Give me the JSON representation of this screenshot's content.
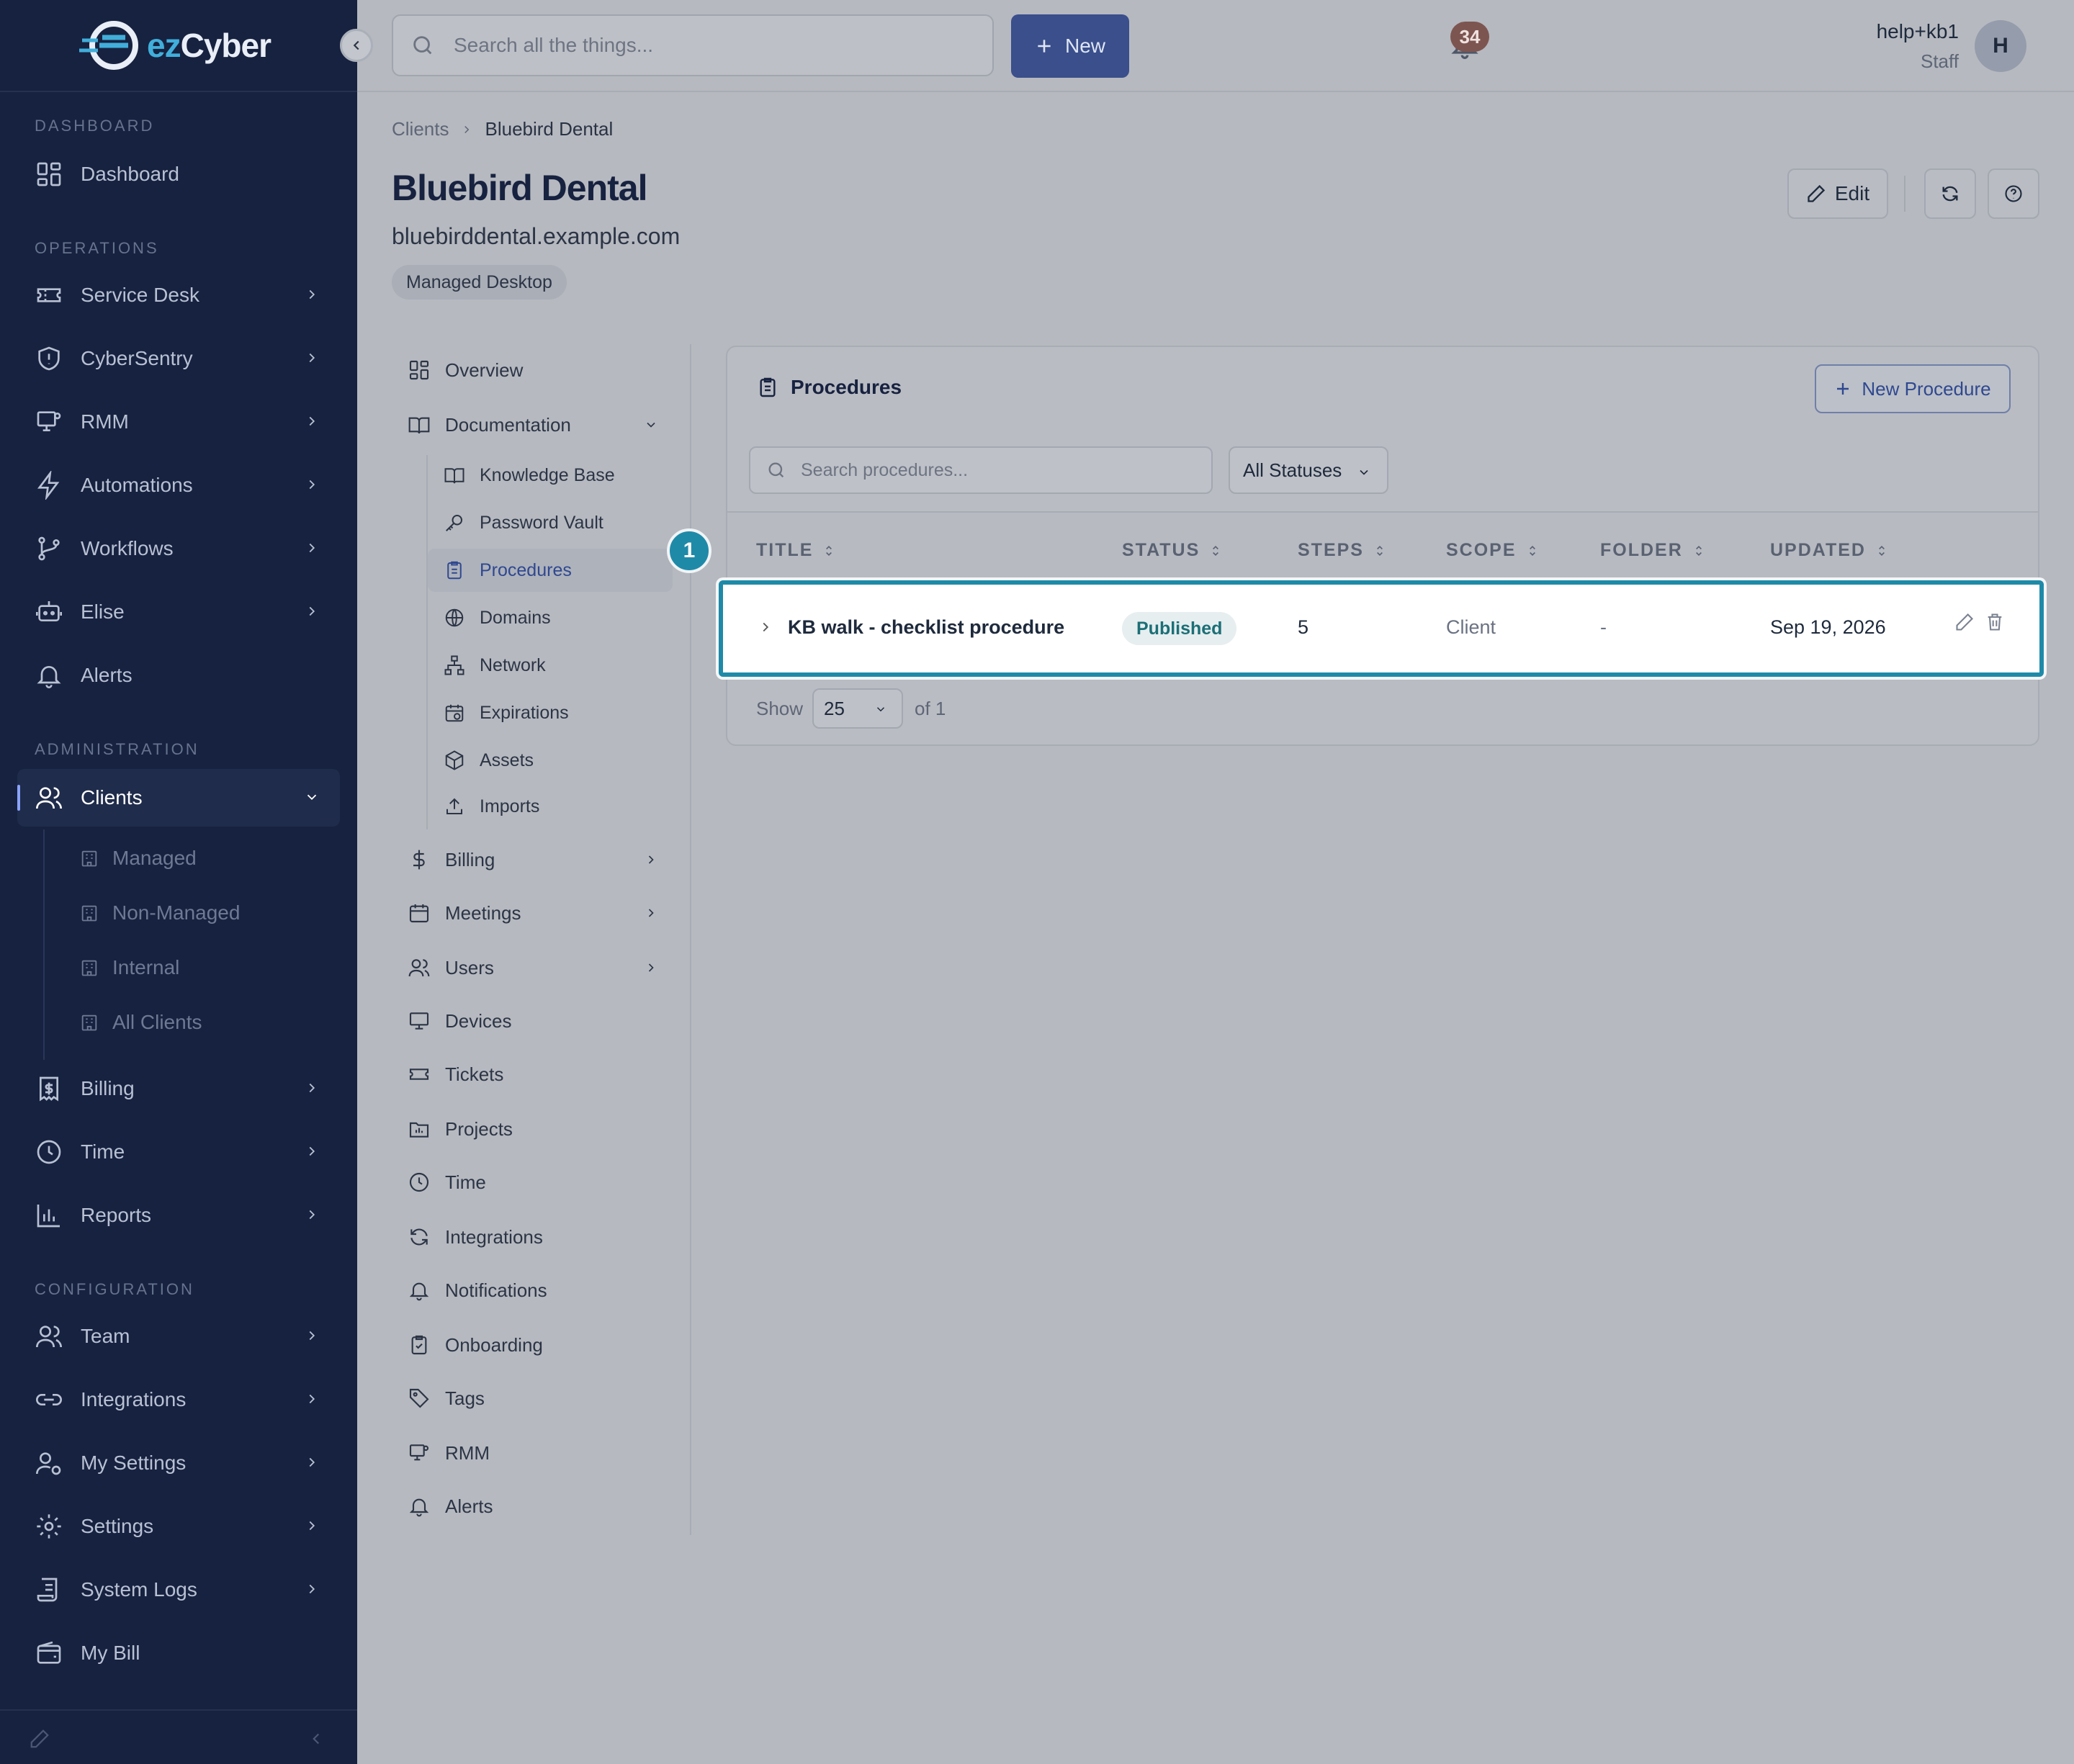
{
  "app": {
    "logo_prefix": "ez",
    "logo_suffix": "Cyber"
  },
  "sidebar": {
    "sections": {
      "dashboard": "DASHBOARD",
      "operations": "OPERATIONS",
      "administration": "ADMINISTRATION",
      "configuration": "CONFIGURATION"
    },
    "items": {
      "dashboard": "Dashboard",
      "service_desk": "Service Desk",
      "cybersentry": "CyberSentry",
      "rmm": "RMM",
      "automations": "Automations",
      "workflows": "Workflows",
      "elise": "Elise",
      "alerts": "Alerts",
      "clients": "Clients",
      "billing": "Billing",
      "time": "Time",
      "reports": "Reports",
      "team": "Team",
      "integrations": "Integrations",
      "my_settings": "My Settings",
      "settings": "Settings",
      "system_logs": "System Logs",
      "my_bill": "My Bill"
    },
    "client_sub": {
      "managed": "Managed",
      "non_managed": "Non-Managed",
      "internal": "Internal",
      "all": "All Clients"
    }
  },
  "topbar": {
    "search_placeholder": "Search all the things...",
    "new_label": "New",
    "notification_count": "34",
    "user_name": "help+kb1",
    "user_role": "Staff",
    "avatar_initial": "H"
  },
  "breadcrumb": {
    "root": "Clients",
    "current": "Bluebird Dental"
  },
  "client": {
    "name": "Bluebird Dental",
    "domain": "bluebirddental.example.com",
    "tag": "Managed Desktop"
  },
  "header_buttons": {
    "edit": "Edit"
  },
  "subnav": {
    "overview": "Overview",
    "documentation": "Documentation",
    "doc_children": {
      "knowledge_base": "Knowledge Base",
      "password_vault": "Password Vault",
      "procedures": "Procedures",
      "domains": "Domains",
      "network": "Network",
      "expirations": "Expirations",
      "assets": "Assets",
      "imports": "Imports"
    },
    "billing": "Billing",
    "meetings": "Meetings",
    "users": "Users",
    "devices": "Devices",
    "tickets": "Tickets",
    "projects": "Projects",
    "time": "Time",
    "integrations": "Integrations",
    "notifications": "Notifications",
    "onboarding": "Onboarding",
    "tags": "Tags",
    "rmm": "RMM",
    "alerts": "Alerts"
  },
  "procedures": {
    "title": "Procedures",
    "new_button": "New Procedure",
    "search_placeholder": "Search procedures...",
    "status_filter": "All Statuses",
    "columns": {
      "title": "TITLE",
      "status": "STATUS",
      "steps": "STEPS",
      "scope": "SCOPE",
      "folder": "FOLDER",
      "updated": "UPDATED"
    },
    "rows": [
      {
        "title": "KB walk - checklist procedure",
        "status": "Published",
        "steps": "5",
        "scope": "Client",
        "folder": "-",
        "updated": "Sep 19, 2026"
      }
    ],
    "pager": {
      "show_label": "Show",
      "page_size": "25",
      "of_label": "of 1"
    }
  },
  "annotation": {
    "step": "1"
  },
  "colors": {
    "sidebar_bg": "#172240",
    "accent": "#3a4f8b",
    "highlight": "#1f8aa8",
    "status_text": "#1c6f76"
  }
}
